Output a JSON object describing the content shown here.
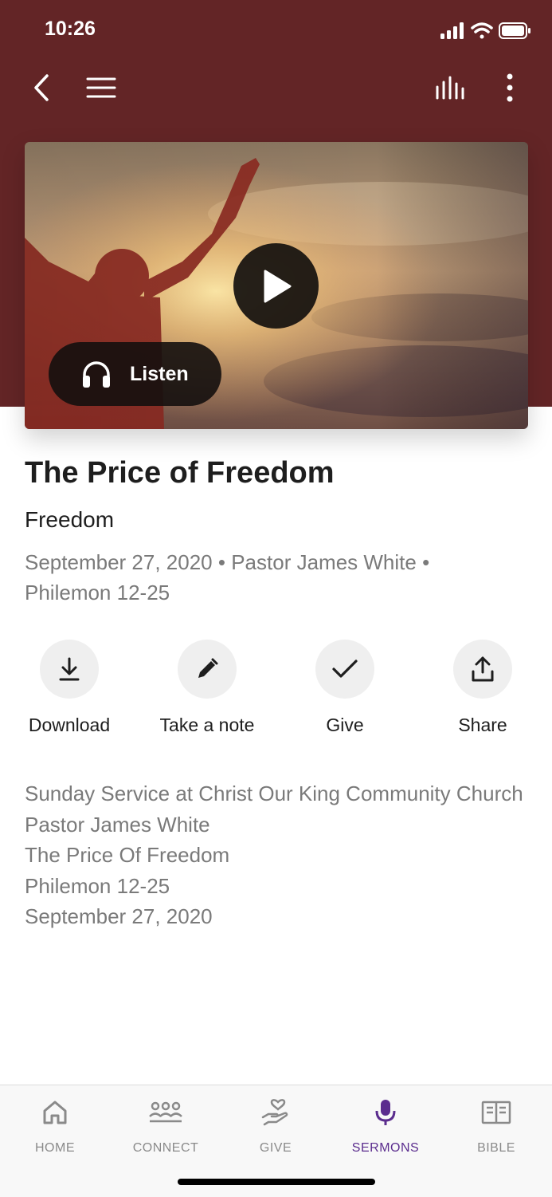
{
  "status_bar": {
    "time": "10:26"
  },
  "header": {
    "back_icon": "chevron-left-icon",
    "menu_icon": "hamburger-icon",
    "audio_icon": "audio-bars-icon",
    "more_icon": "vertical-dots-icon",
    "background_color": "#632526"
  },
  "hero": {
    "play_icon": "play-icon",
    "listen_label": "Listen",
    "listen_icon": "headphones-icon"
  },
  "sermon": {
    "title": "The Price of Freedom",
    "series": "Freedom",
    "date": "September 27, 2020",
    "speaker": "Pastor James White",
    "separator": "•",
    "passage": "Philemon 12-25"
  },
  "actions": [
    {
      "label": "Download",
      "icon": "download-icon"
    },
    {
      "label": "Take a note",
      "icon": "pencil-icon"
    },
    {
      "label": "Give",
      "icon": "checkmark-icon"
    },
    {
      "label": "Share",
      "icon": "share-icon"
    }
  ],
  "description": [
    "Sunday Service at Christ Our King Community Church",
    "Pastor James White",
    "The Price Of Freedom",
    "Philemon 12-25",
    "September 27, 2020"
  ],
  "tabbar": {
    "active_color": "#5b2d8e",
    "tabs": [
      {
        "label": "HOME",
        "icon": "home-icon",
        "active": false
      },
      {
        "label": "CONNECT",
        "icon": "people-icon",
        "active": false
      },
      {
        "label": "GIVE",
        "icon": "hand-heart-icon",
        "active": false
      },
      {
        "label": "SERMONS",
        "icon": "microphone-icon",
        "active": true
      },
      {
        "label": "BIBLE",
        "icon": "book-icon",
        "active": false
      }
    ]
  }
}
